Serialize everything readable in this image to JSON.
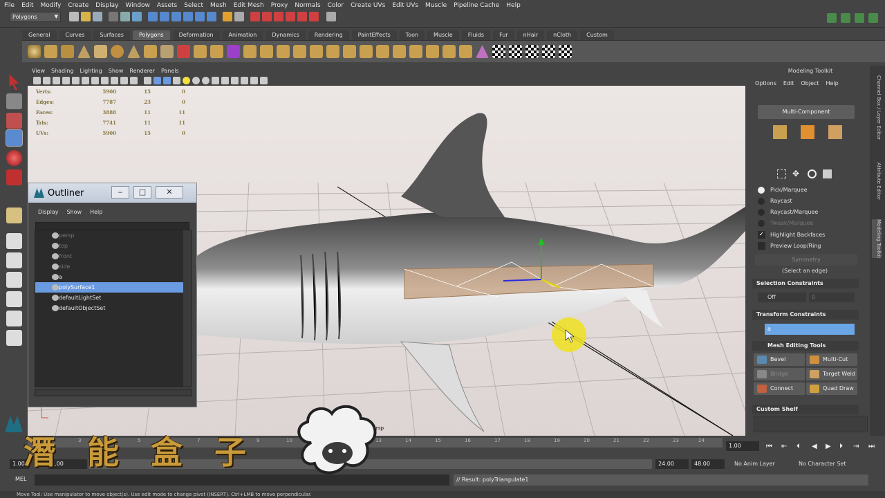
{
  "menubar": [
    "File",
    "Edit",
    "Modify",
    "Create",
    "Display",
    "Window",
    "Assets",
    "Select",
    "Mesh",
    "Edit Mesh",
    "Proxy",
    "Normals",
    "Color",
    "Create UVs",
    "Edit UVs",
    "Muscle",
    "Pipeline Cache",
    "Help"
  ],
  "status": {
    "mode": "Polygons"
  },
  "shelf": {
    "tabs": [
      "General",
      "Curves",
      "Surfaces",
      "Polygons",
      "Deformation",
      "Animation",
      "Dynamics",
      "Rendering",
      "PaintEffects",
      "Toon",
      "Muscle",
      "Fluids",
      "Fur",
      "nHair",
      "nCloth",
      "Custom"
    ],
    "active": "Polygons"
  },
  "viewport": {
    "menu": [
      "View",
      "Shading",
      "Lighting",
      "Show",
      "Renderer",
      "Panels"
    ],
    "camera_label": "persp",
    "hud": [
      {
        "label": "Verts:",
        "a": "5900",
        "b": "15",
        "c": "0"
      },
      {
        "label": "Edges:",
        "a": "7787",
        "b": "23",
        "c": "0"
      },
      {
        "label": "Faces:",
        "a": "3888",
        "b": "11",
        "c": "11"
      },
      {
        "label": "Tris:",
        "a": "7741",
        "b": "11",
        "c": "11"
      },
      {
        "label": "UVs:",
        "a": "5900",
        "b": "15",
        "c": "0"
      }
    ]
  },
  "outliner": {
    "title": "Outliner",
    "menu": [
      "Display",
      "Show",
      "Help"
    ],
    "items": [
      {
        "label": "persp",
        "dim": true
      },
      {
        "label": "top",
        "dim": true
      },
      {
        "label": "front",
        "dim": true
      },
      {
        "label": "side",
        "dim": true
      },
      {
        "label": "a",
        "dim": false
      },
      {
        "label": "polySurface1",
        "selected": true
      },
      {
        "label": "defaultLightSet",
        "dim": false
      },
      {
        "label": "defaultObjectSet",
        "dim": false
      }
    ]
  },
  "toolkit": {
    "title": "Modeling Toolkit",
    "menu": [
      "Options",
      "Edit",
      "Object",
      "Help"
    ],
    "multi_component": "Multi-Component",
    "pick_options": [
      "Pick/Marquee",
      "Raycast",
      "Raycast/Marquee",
      "Tweak/Marquee"
    ],
    "highlight_backfaces": "Highlight Backfaces",
    "preview_loop": "Preview Loop/Ring",
    "symmetry": "Symmetry",
    "select_hint": "(Select an edge)",
    "selection_constraints": "Selection Constraints",
    "constraint_value": "Off",
    "constraint_num": "0",
    "transform_constraints": "Transform Constraints",
    "transform_value": "a",
    "mesh_editing_tools": "Mesh Editing Tools",
    "tools": [
      "Bevel",
      "Multi-Cut",
      "Bridge",
      "Target Weld",
      "Connect",
      "Quad Draw"
    ],
    "custom_shelf": "Custom Shelf"
  },
  "sidetabs": [
    "Channel Box / Layer Editor",
    "Attribute Editor",
    "Modeling Toolkit"
  ],
  "timeline": {
    "ticks": [
      "2",
      "3",
      "4",
      "5",
      "6",
      "7",
      "8",
      "9",
      "10",
      "11",
      "12",
      "13",
      "14",
      "15",
      "16",
      "17",
      "18",
      "19",
      "20",
      "21",
      "22",
      "23",
      "24"
    ],
    "current": "1.00"
  },
  "range": {
    "start": "1.00",
    "start2": "1.00",
    "mid": "24",
    "end": "24.00",
    "end2": "48.00",
    "anim_layer": "No Anim Layer",
    "char_set": "No Character Set"
  },
  "cmd": {
    "label": "MEL",
    "result": "// Result: polyTriangulate1"
  },
  "helpline": "Move Tool: Use manipulator to move object(s). Use edit mode to change pivot (INSERT). Ctrl+LMB to move perpendicular.",
  "watermark": [
    "潛",
    "能",
    "盒",
    "子"
  ]
}
